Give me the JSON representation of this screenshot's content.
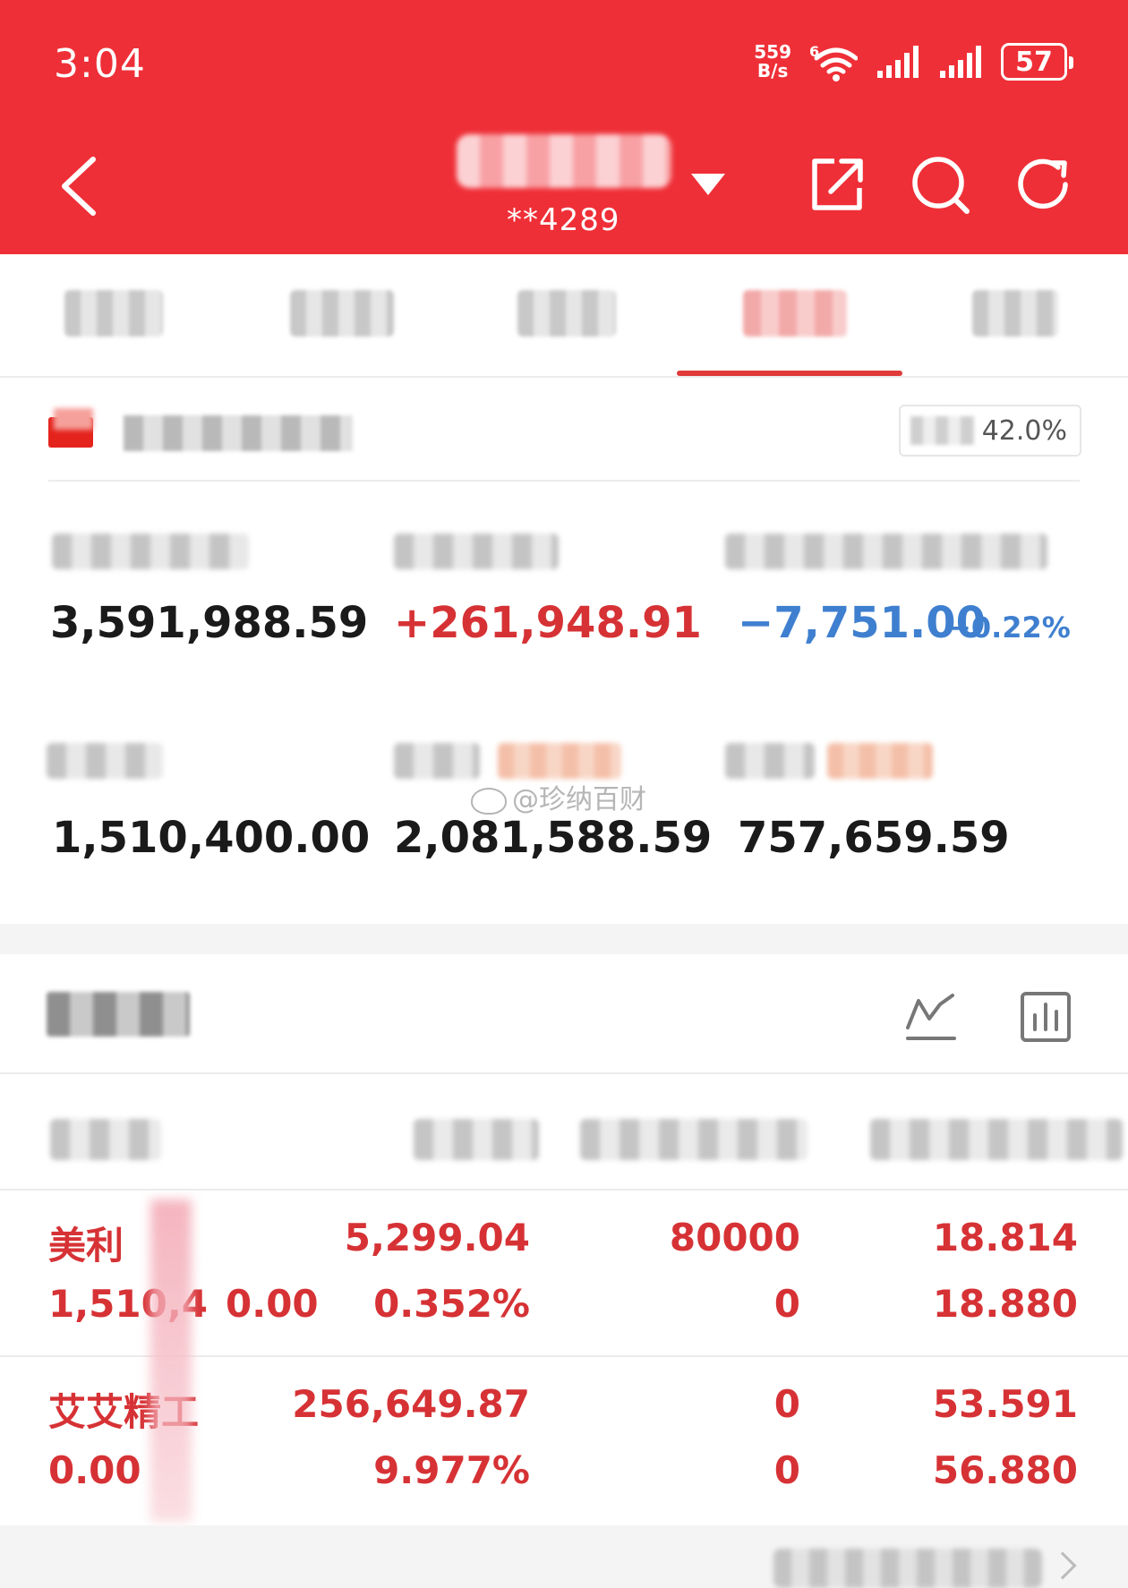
{
  "status_bar": {
    "time": "3:04",
    "net_speed_value": "559",
    "net_speed_unit": "B/s",
    "battery": "57",
    "icons": [
      "wifi-6-icon",
      "signal-icon",
      "signal-icon",
      "battery-icon"
    ]
  },
  "header": {
    "account_mask": "**4289",
    "icons": [
      "back-icon",
      "dropdown-caret-icon",
      "share-icon",
      "search-icon",
      "refresh-icon"
    ]
  },
  "tabs": {
    "active_index": 3
  },
  "account": {
    "position_ratio": "42.0%"
  },
  "metrics": {
    "total_assets": "3,591,988.59",
    "floating_pnl": "+261,948.91",
    "today_pnl": "−7,751.00",
    "today_pnl_pct": "−0.22%",
    "market_value": "1,510,400.00",
    "metric_5": "2,081,588.59",
    "metric_6": "757,659.59"
  },
  "watermark": "@珍纳百财",
  "holdings": {
    "icons": [
      "trend-line-icon",
      "bar-chart-icon"
    ],
    "rows": [
      {
        "name": "美利",
        "market_value": "1,510,4",
        "market_value_tail": "0.00",
        "pnl": "5,299.04",
        "pnl_pct": "0.352%",
        "hold_qty": "80000",
        "available_qty": "0",
        "cost_price": "18.814",
        "current_price": "18.880"
      },
      {
        "name": "艾艾精工",
        "market_value": "0.00",
        "pnl": "256,649.87",
        "pnl_pct": "9.977%",
        "hold_qty": "0",
        "available_qty": "0",
        "cost_price": "53.591",
        "current_price": "56.880"
      }
    ]
  },
  "colors": {
    "brand_red": "#ef2f37",
    "up_red": "#d63235",
    "down_blue": "#3f7fcf"
  }
}
